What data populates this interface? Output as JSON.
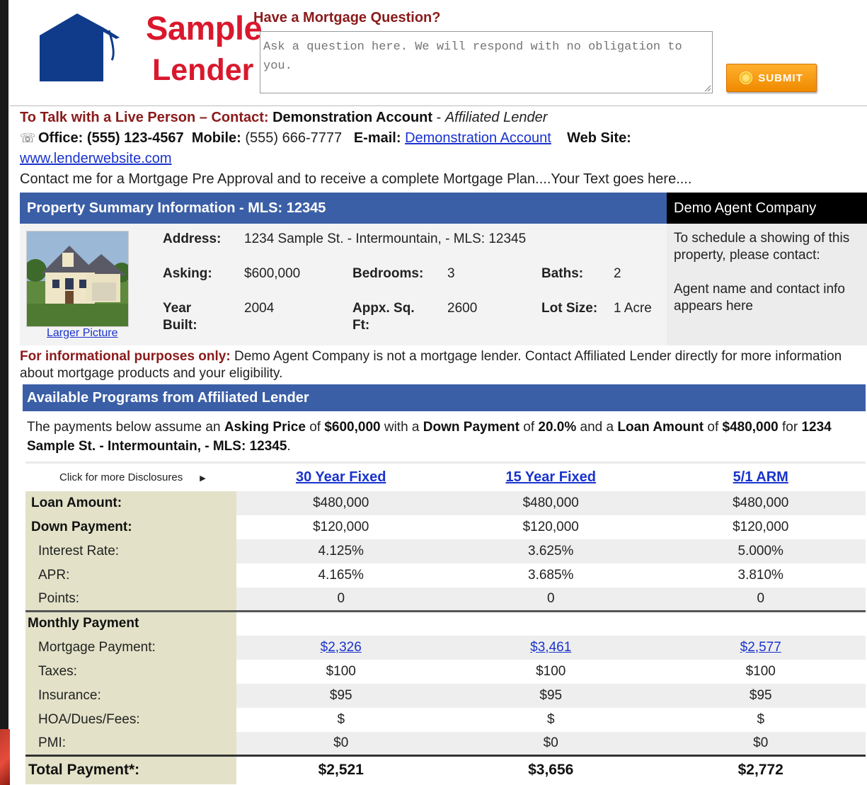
{
  "colors": {
    "brand_red": "#d9182d",
    "header_blue": "#3b5fa6",
    "submit_orange": "#f08a00",
    "label_col": "#e3e2c8"
  },
  "logo": {
    "line1": "Sample",
    "line2": "Lender"
  },
  "question": {
    "title": "Have a Mortgage Question?",
    "placeholder": "Ask a question here. We will respond with no obligation to you.",
    "submit_label": "SUBMIT"
  },
  "contact": {
    "talk_label": "To Talk with a Live Person – Contact:",
    "name": "Demonstration Account",
    "separator": " - ",
    "role": "Affiliated Lender",
    "office_label": "Office:",
    "office_phone": "(555) 123-4567",
    "mobile_label": "Mobile:",
    "mobile_phone": "(555) 666-7777",
    "email_label": "E-mail:",
    "email_link": "Demonstration Account",
    "website_label": "Web Site:",
    "website_link": "www.lenderwebsite.com",
    "blurb": "Contact me for a Mortgage Pre Approval and to receive a complete Mortgage Plan....Your Text goes here...."
  },
  "property": {
    "header": "Property Summary Information - MLS: 12345",
    "larger_picture": "Larger Picture",
    "address_label": "Address:",
    "address": "1234 Sample St. - Intermountain, - MLS: 12345",
    "asking_label": "Asking:",
    "asking": "$600,000",
    "bedrooms_label": "Bedrooms:",
    "bedrooms": "3",
    "baths_label": "Baths:",
    "baths": "2",
    "year_label": "Year Built:",
    "year": "2004",
    "sqft_label": "Appx. Sq. Ft:",
    "sqft": "2600",
    "lot_label": "Lot Size:",
    "lot": "1 Acre"
  },
  "agent": {
    "company": "Demo Agent Company",
    "schedule_text": "To schedule a showing of this property, please contact:",
    "contact_text": "Agent name and contact info appears here"
  },
  "disclaimer": {
    "bold": "For informational purposes only:",
    "text": " Demo Agent Company is not a mortgage lender. Contact Affiliated Lender directly for more information about mortgage products and your eligibility."
  },
  "programs": {
    "header": "Available Programs from Affiliated Lender",
    "intro": {
      "t1": "The payments below assume an ",
      "b1": "Asking Price",
      "t2": " of ",
      "b2": "$600,000",
      "t3": " with a ",
      "b3": "Down Payment",
      "t4": " of ",
      "b4": "20.0%",
      "t5": " and a ",
      "b5": "Loan Amount",
      "t6": " of ",
      "b6": "$480,000",
      "t7": " for ",
      "b7": "1234 Sample St. - Intermountain, - MLS: 12345",
      "t8": "."
    },
    "disclosures_label": "Click for more Disclosures",
    "columns": [
      "30 Year Fixed",
      "15 Year Fixed",
      "5/1 ARM"
    ],
    "rows": {
      "loan_amount": {
        "label": "Loan Amount:",
        "values": [
          "$480,000",
          "$480,000",
          "$480,000"
        ]
      },
      "down_payment": {
        "label": "Down Payment:",
        "values": [
          "$120,000",
          "$120,000",
          "$120,000"
        ]
      },
      "interest_rate": {
        "label": "Interest Rate:",
        "values": [
          "4.125%",
          "3.625%",
          "5.000%"
        ]
      },
      "apr": {
        "label": "APR:",
        "values": [
          "4.165%",
          "3.685%",
          "3.810%"
        ]
      },
      "points": {
        "label": "Points:",
        "values": [
          "0",
          "0",
          "0"
        ]
      },
      "monthly_header": {
        "label": "Monthly Payment"
      },
      "mortgage_payment": {
        "label": "Mortgage Payment:",
        "values": [
          "$2,326",
          "$3,461",
          "$2,577"
        ]
      },
      "taxes": {
        "label": "Taxes:",
        "values": [
          "$100",
          "$100",
          "$100"
        ]
      },
      "insurance": {
        "label": "Insurance:",
        "values": [
          "$95",
          "$95",
          "$95"
        ]
      },
      "hoa": {
        "label": "HOA/Dues/Fees:",
        "values": [
          "$",
          "$",
          "$"
        ]
      },
      "pmi": {
        "label": "PMI:",
        "values": [
          "$0",
          "$0",
          "$0"
        ]
      },
      "total": {
        "label": "Total Payment*:",
        "values": [
          "$2,521",
          "$3,656",
          "$2,772"
        ]
      }
    }
  }
}
